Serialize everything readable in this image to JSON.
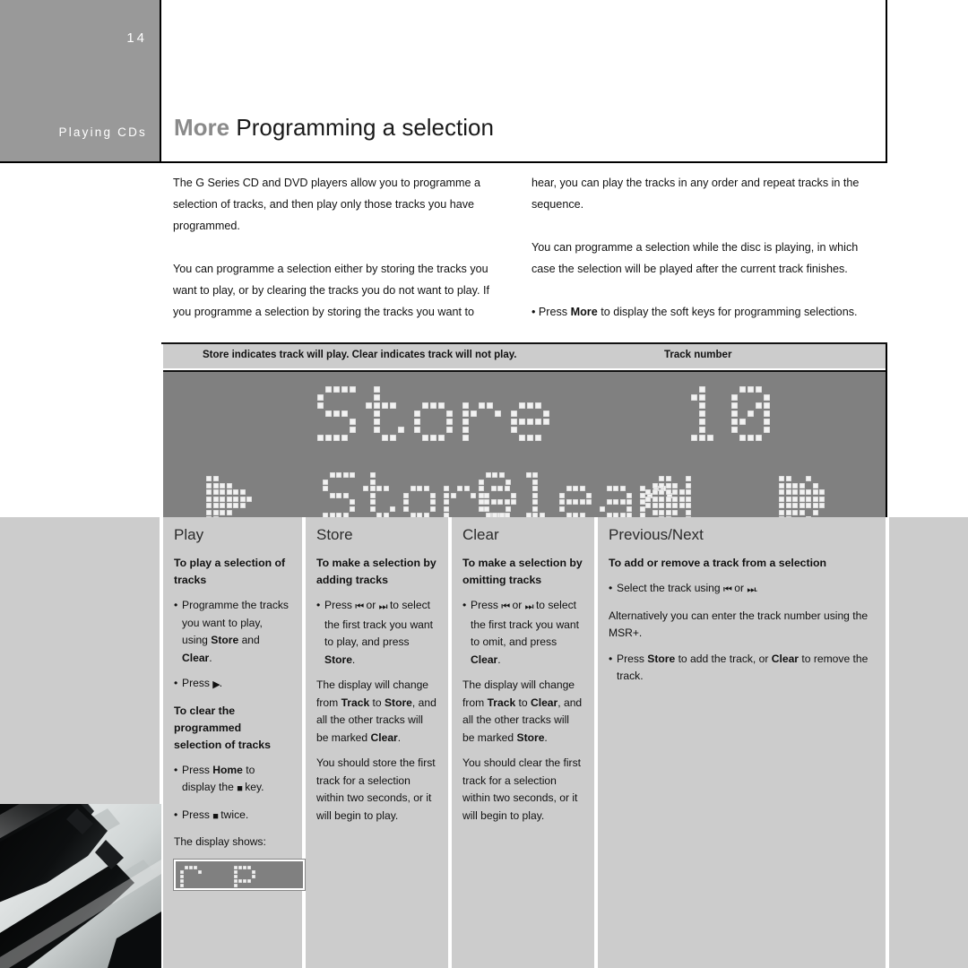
{
  "page": {
    "number": "14",
    "section": "Playing CDs",
    "title_prefix": "More",
    "title": "Programming a selection"
  },
  "intro": {
    "left": [
      "The G Series CD and DVD players allow you to programme a selection of tracks, and then play only those tracks you have programmed.",
      "You can programme a selection either by storing the tracks you want to play, or by clearing the tracks you do not want to play. If you programme a selection by storing the tracks you want to"
    ],
    "right_1": "hear, you can play the tracks in any order and repeat tracks in the sequence.",
    "right_2": "You can programme a selection while the disc is playing, in which case the selection will be played after the current track finishes.",
    "right_3_pre": "• Press ",
    "right_3_bold": "More",
    "right_3_post": " to display the soft keys for programming selections."
  },
  "caption": {
    "main": "Store indicates track will play. Clear indicates track will not play.",
    "track": "Track number"
  },
  "display": {
    "main_text": "Store",
    "track_number": "10",
    "soft_keys": [
      {
        "name": "play-icon",
        "label": "▶"
      },
      {
        "name": "store-soft-key",
        "label": "Store"
      },
      {
        "name": "clear-soft-key",
        "label": "Clear"
      },
      {
        "name": "previous-icon",
        "label": "⏮"
      },
      {
        "name": "next-icon",
        "label": "⏭"
      }
    ],
    "background_color": "#808080",
    "dot_color": "#f2f2f2"
  },
  "columns": [
    {
      "title": "Play",
      "sub": "To play a selection of tracks",
      "blocks": [
        {
          "type": "bullet",
          "runs": [
            {
              "t": "Programme the tracks you want to play, using "
            },
            {
              "t": "Store",
              "b": true
            },
            {
              "t": " and "
            },
            {
              "t": "Clear",
              "b": true
            },
            {
              "t": "."
            }
          ]
        },
        {
          "type": "bullet",
          "runs": [
            {
              "t": "Press "
            },
            {
              "t": "▶",
              "icon": true
            },
            {
              "t": "."
            }
          ]
        },
        {
          "type": "sub",
          "runs": [
            {
              "t": "To clear the programmed selection of tracks"
            }
          ]
        },
        {
          "type": "bullet",
          "runs": [
            {
              "t": "Press "
            },
            {
              "t": "Home",
              "b": true
            },
            {
              "t": " to display the "
            },
            {
              "t": "■",
              "icon": true
            },
            {
              "t": " key."
            }
          ]
        },
        {
          "type": "bullet",
          "runs": [
            {
              "t": "Press "
            },
            {
              "t": "■",
              "icon": true
            },
            {
              "t": " twice."
            }
          ]
        },
        {
          "type": "para",
          "runs": [
            {
              "t": "The display shows:"
            }
          ]
        },
        {
          "type": "mini-display",
          "text": "C.P."
        }
      ]
    },
    {
      "title": "Store",
      "sub": "To make a selection by adding tracks",
      "blocks": [
        {
          "type": "bullet",
          "runs": [
            {
              "t": "Press "
            },
            {
              "t": "⏮",
              "icon": true
            },
            {
              "t": " or "
            },
            {
              "t": "⏭",
              "icon": true
            },
            {
              "t": " to select the first track you want to play, and press "
            },
            {
              "t": "Store",
              "b": true
            },
            {
              "t": "."
            }
          ]
        },
        {
          "type": "para",
          "runs": [
            {
              "t": "The display will change from "
            },
            {
              "t": "Track",
              "b": true
            },
            {
              "t": " to "
            },
            {
              "t": "Store",
              "b": true
            },
            {
              "t": ", and all the other tracks will be marked "
            },
            {
              "t": "Clear",
              "b": true
            },
            {
              "t": "."
            }
          ]
        },
        {
          "type": "para",
          "runs": [
            {
              "t": "You should store the first track for a selection within two seconds, or it will begin to play."
            }
          ]
        }
      ]
    },
    {
      "title": "Clear",
      "sub": "To make a selection by omitting tracks",
      "blocks": [
        {
          "type": "bullet",
          "runs": [
            {
              "t": "Press "
            },
            {
              "t": "⏮",
              "icon": true
            },
            {
              "t": " or "
            },
            {
              "t": "⏭",
              "icon": true
            },
            {
              "t": " to select the first track you want to omit, and press "
            },
            {
              "t": "Clear",
              "b": true
            },
            {
              "t": "."
            }
          ]
        },
        {
          "type": "para",
          "runs": [
            {
              "t": "The display will change from "
            },
            {
              "t": "Track",
              "b": true
            },
            {
              "t": " to "
            },
            {
              "t": "Clear",
              "b": true
            },
            {
              "t": ", and all the other tracks will be marked "
            },
            {
              "t": "Store",
              "b": true
            },
            {
              "t": "."
            }
          ]
        },
        {
          "type": "para",
          "runs": [
            {
              "t": "You should clear the first track for a selection within two seconds, or it will begin to play."
            }
          ]
        }
      ]
    },
    {
      "title": "Previous/Next",
      "sub": "To add or remove a track from a selection",
      "blocks": [
        {
          "type": "bullet",
          "runs": [
            {
              "t": "Select the track using "
            },
            {
              "t": "⏮",
              "icon": true
            },
            {
              "t": " or "
            },
            {
              "t": "⏭",
              "icon": true
            },
            {
              "t": "."
            }
          ]
        },
        {
          "type": "para",
          "runs": [
            {
              "t": "Alternatively you can enter the track number using the MSR+."
            }
          ]
        },
        {
          "type": "bullet",
          "runs": [
            {
              "t": "Press "
            },
            {
              "t": "Store",
              "b": true
            },
            {
              "t": " to add the track, or "
            },
            {
              "t": "Clear",
              "b": true
            },
            {
              "t": " to remove the track."
            }
          ]
        }
      ]
    }
  ],
  "photo": {
    "name": "piano-keys-photo",
    "description": "Black and white close-up of piano keys"
  },
  "colors": {
    "header_gray": "#999999",
    "column_gray": "#cccccc",
    "display_gray": "#808080",
    "rule_black": "#111111"
  }
}
